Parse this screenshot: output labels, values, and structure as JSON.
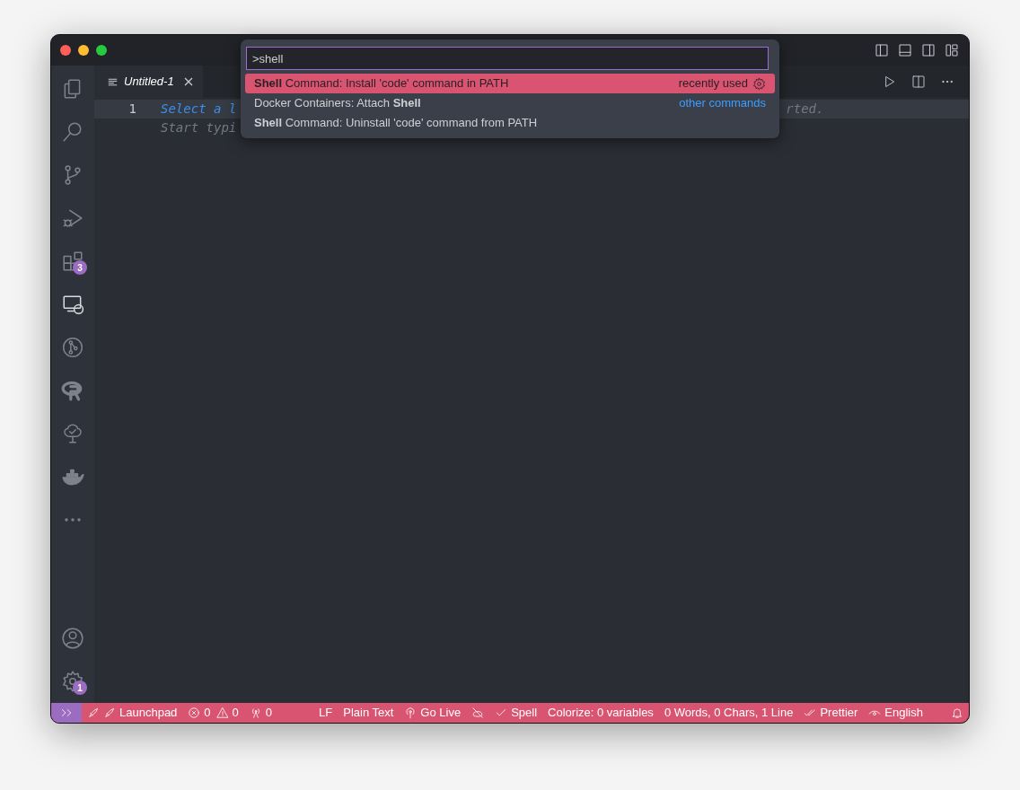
{
  "activity_bar": {
    "items": [
      {
        "kind": "files",
        "selected": false
      },
      {
        "kind": "search",
        "selected": false
      },
      {
        "kind": "branch",
        "selected": false
      },
      {
        "kind": "debug",
        "selected": false
      },
      {
        "kind": "extensions",
        "selected": false,
        "badge": "3"
      },
      {
        "kind": "remote",
        "selected": true
      },
      {
        "kind": "graph",
        "selected": false
      },
      {
        "kind": "r",
        "selected": false
      },
      {
        "kind": "tree",
        "selected": false
      },
      {
        "kind": "whale",
        "selected": false
      },
      {
        "kind": "more",
        "selected": false
      }
    ],
    "bottom_items": [
      {
        "kind": "account",
        "selected": false
      },
      {
        "kind": "settings",
        "selected": false,
        "badge": "1"
      }
    ]
  },
  "tabs": [
    {
      "label": "Untitled-1",
      "selected": true
    }
  ],
  "editor": {
    "lines": [
      {
        "number": "1",
        "current": true,
        "segments": [
          {
            "kind": "link",
            "text": "Select a l"
          },
          {
            "kind": "hint",
            "text": "rted."
          }
        ]
      },
      {
        "current": false,
        "segments": [
          {
            "kind": "hint",
            "text": "Start typi"
          }
        ]
      }
    ]
  },
  "command_palette": {
    "value": ">shell",
    "items": [
      {
        "label": "**Shell** Command: Install 'code' command in PATH",
        "detail": "recently used",
        "selected": true
      },
      {
        "label": "Docker Containers: Attach **Shell**",
        "detail": "other commands",
        "selected": false
      },
      {
        "label": "**Shell** Command: Uninstall 'code' command from PATH",
        "selected": false
      }
    ]
  },
  "status_bar": {
    "items": [
      {
        "kind": "remote"
      },
      {
        "kind": "launchpad",
        "text": "Launchpad"
      },
      {
        "kind": "errors",
        "text": "0"
      },
      {
        "kind": "warnings",
        "text": "0"
      },
      {
        "kind": "ports",
        "text": "0"
      },
      {
        "kind": "plain",
        "text": "LF"
      },
      {
        "kind": "plain",
        "text": "Plain Text"
      },
      {
        "kind": "live",
        "text": "Go Live"
      },
      {
        "kind": "nocopilot"
      },
      {
        "kind": "check",
        "text": "Spell"
      },
      {
        "kind": "plain",
        "text": "Colorize: 0 variables"
      },
      {
        "kind": "plain",
        "text": "0 Words, 0 Chars, 1 Line"
      },
      {
        "kind": "doublecheck",
        "text": "Prettier"
      },
      {
        "kind": "eye",
        "text": "English"
      },
      {
        "kind": "bell"
      }
    ]
  }
}
